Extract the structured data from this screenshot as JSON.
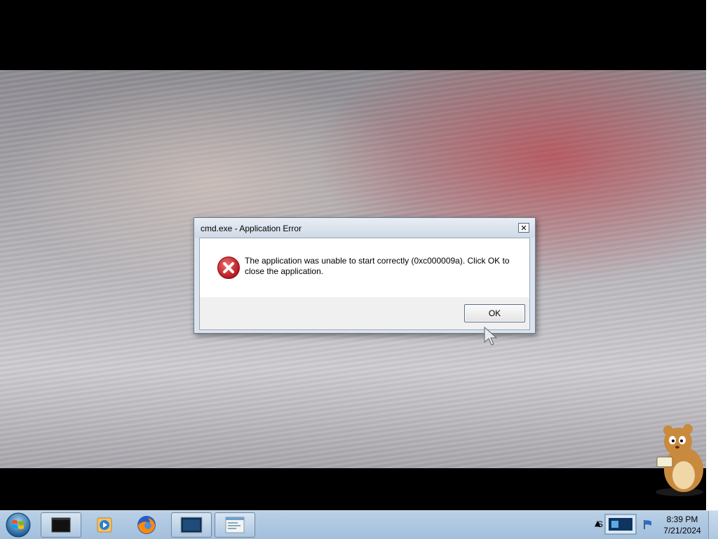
{
  "dialog": {
    "title": "cmd.exe - Application Error",
    "message": "The application was unable to start correctly (0xc000009a). Click OK to close the application.",
    "ok_label": "OK",
    "close_glyph": "✕",
    "icon": "error-icon"
  },
  "taskbar": {
    "start_icon": "windows-logo-icon",
    "buttons": [
      {
        "name": "terminal-window-icon"
      },
      {
        "name": "media-player-icon"
      },
      {
        "name": "firefox-icon"
      },
      {
        "name": "monitor-window-icon"
      },
      {
        "name": "document-window-icon"
      }
    ],
    "tray": {
      "arrow": "▲",
      "label": "S",
      "network_icon": "network-icon",
      "flag_icon": "action-center-icon"
    },
    "clock": {
      "time": "8:39 PM",
      "date": "7/21/2024"
    }
  },
  "colors": {
    "taskbar": "#a3bfdc",
    "dialog_frame": "#dbe3ec",
    "error_red": "#d2262b"
  }
}
